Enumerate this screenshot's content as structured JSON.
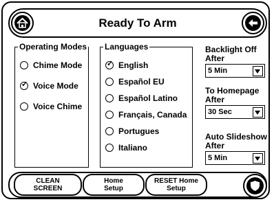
{
  "header": {
    "title": "Ready To Arm",
    "home_icon": "home-icon",
    "back_icon": "back-arrow-icon"
  },
  "operating_modes": {
    "legend": "Operating Modes",
    "options": [
      {
        "label": "Chime Mode",
        "checked": false
      },
      {
        "label": "Voice Mode",
        "checked": true
      },
      {
        "label": "Voice Chime",
        "checked": false
      }
    ]
  },
  "languages": {
    "legend": "Languages",
    "options": [
      {
        "label": "English",
        "checked": true
      },
      {
        "label": "Español EU",
        "checked": false
      },
      {
        "label": "Español Latino",
        "checked": false
      },
      {
        "label": "Français, Canada",
        "checked": false
      },
      {
        "label": "Portugues",
        "checked": false
      },
      {
        "label": "Italiano",
        "checked": false
      }
    ]
  },
  "settings": {
    "backlight_label": "Backlight Off After",
    "backlight_value": "5 Min",
    "homepage_label": "To Homepage After",
    "homepage_value": "30 Sec",
    "slideshow_label": "Auto Slideshow After",
    "slideshow_value": "5 Min"
  },
  "footer": {
    "clean_screen": "CLEAN SCREEN",
    "home_setup": "Home Setup",
    "reset_home_setup": "RESET Home Setup",
    "shield_icon": "shield-icon"
  }
}
